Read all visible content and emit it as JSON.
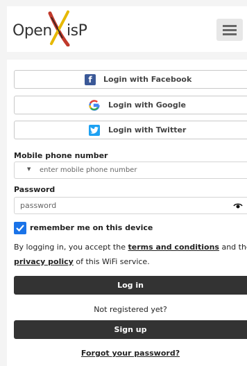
{
  "header": {
    "logo_left": "Open",
    "logo_right": "isP",
    "menu_icon": "hamburger-menu-icon"
  },
  "social": {
    "facebook": "Login with Facebook",
    "google": "Login with Google",
    "twitter": "Login with Twitter"
  },
  "form": {
    "phone_label": "Mobile phone number",
    "phone_placeholder": "enter mobile phone number",
    "password_label": "Password",
    "password_placeholder": "password",
    "remember_label": "remember me on this device"
  },
  "terms": {
    "line1_before": "By logging in, you accept the ",
    "terms_link": "terms and conditions",
    "line1_after": " and the",
    "privacy_link": "privacy policy",
    "line2_after": " of this WiFi service."
  },
  "actions": {
    "login": "Log in",
    "not_registered": "Not registered yet?",
    "signup": "Sign up",
    "forgot": "Forgot your password?"
  },
  "colors": {
    "facebook": "#3b5998",
    "twitter": "#1da1f2",
    "checkbox": "#1a73e8",
    "button": "#333333"
  }
}
